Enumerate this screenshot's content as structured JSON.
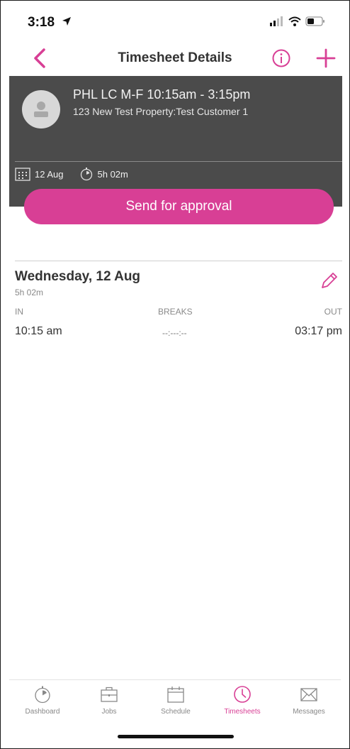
{
  "status_bar": {
    "time": "3:18"
  },
  "nav": {
    "title": "Timesheet Details"
  },
  "job": {
    "title": "PHL LC M-F 10:15am - 3:15pm",
    "subtitle": "123 New Test Property:Test Customer 1",
    "date": "12 Aug",
    "duration": "5h 02m"
  },
  "approve_label": "Send for approval",
  "entry": {
    "day": "Wednesday, 12 Aug",
    "duration": "5h 02m",
    "columns": {
      "in": "IN",
      "breaks": "BREAKS",
      "out": "OUT"
    },
    "values": {
      "in": "10:15 am",
      "breaks": "--:---:--",
      "out": "03:17 pm"
    }
  },
  "tabs": [
    {
      "label": "Dashboard",
      "icon": "stopwatch-icon"
    },
    {
      "label": "Jobs",
      "icon": "briefcase-icon"
    },
    {
      "label": "Schedule",
      "icon": "calendar-icon"
    },
    {
      "label": "Timesheets",
      "icon": "clock-icon",
      "active": true
    },
    {
      "label": "Messages",
      "icon": "envelope-icon"
    }
  ],
  "colors": {
    "accent": "#d83f95",
    "header_bg": "#4b4b4b"
  }
}
